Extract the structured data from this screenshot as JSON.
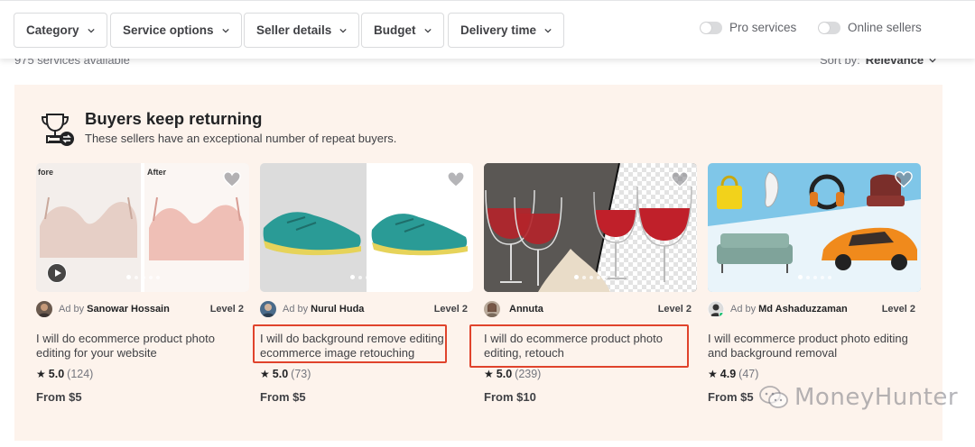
{
  "filters": [
    {
      "label": "Category"
    },
    {
      "label": "Service options"
    },
    {
      "label": "Seller details"
    },
    {
      "label": "Budget"
    },
    {
      "label": "Delivery time"
    }
  ],
  "toggles": [
    {
      "label": "Pro services"
    },
    {
      "label": "Online sellers"
    }
  ],
  "results": {
    "count_text": "975 services available",
    "sort_label": "Sort by:",
    "sort_value": "Relevance"
  },
  "section": {
    "title": "Buyers keep returning",
    "subtitle": "These sellers have an exceptional number of repeat buyers."
  },
  "cards": [
    {
      "ad": "Ad by",
      "seller": "Sanowar Hossain",
      "level": "Level 2",
      "title": "I will do ecommerce product photo editing for your website",
      "rating": "5.0",
      "reviews": "(124)",
      "price": "From $5",
      "thumb_text": [
        "fore",
        "After"
      ]
    },
    {
      "ad": "Ad by",
      "seller": "Nurul Huda",
      "level": "Level 2",
      "title": "I will do background remove editing ecommerce image retouching",
      "rating": "5.0",
      "reviews": "(73)",
      "price": "From $5"
    },
    {
      "ad": "",
      "seller": "Annuta",
      "level": "Level 2",
      "title": "I will do ecommerce product photo editing, retouch",
      "rating": "5.0",
      "reviews": "(239)",
      "price": "From $10"
    },
    {
      "ad": "Ad by",
      "seller": "Md Ashaduzzaman",
      "level": "Level 2",
      "title": "I will ecommerce product photo editing and background removal",
      "rating": "4.9",
      "reviews": "(47)",
      "price": "From $5"
    }
  ],
  "watermark": "MoneyHunter",
  "colors": {
    "section_bg": "#fdf3ec",
    "highlight": "#e0432c",
    "text": "#222325",
    "muted": "#74767e"
  }
}
